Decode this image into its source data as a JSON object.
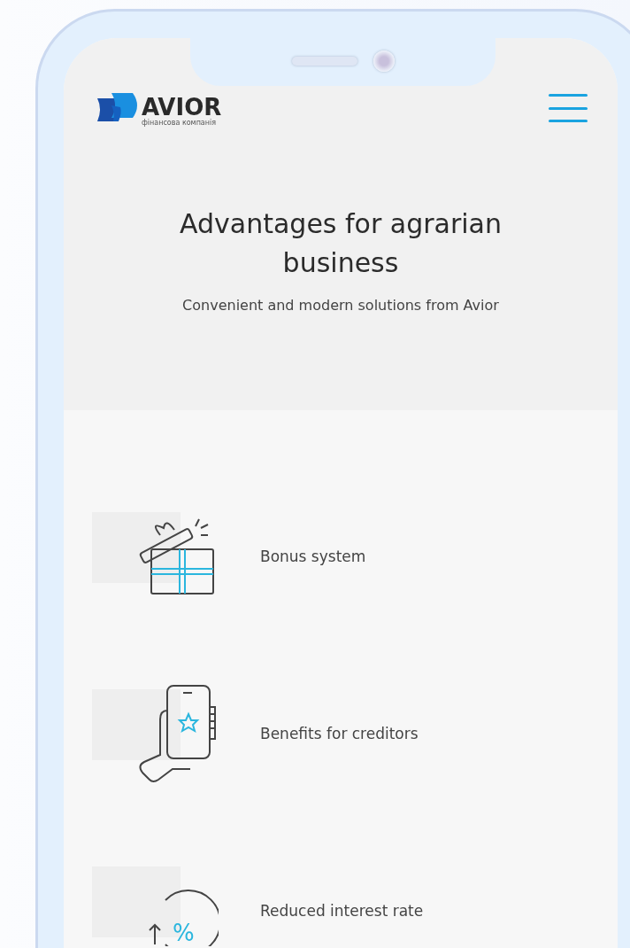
{
  "header": {
    "logo_text": "AVIOR",
    "logo_subtitle": "фінансова компанія"
  },
  "hero": {
    "title": "Advantages for agrarian business",
    "subtitle": "Convenient and modern solutions from Avior"
  },
  "advantages": [
    {
      "kind": "gift",
      "label": "Bonus system"
    },
    {
      "kind": "phone",
      "label": "Benefits for creditors"
    },
    {
      "kind": "percent",
      "label": "Reduced interest rate",
      "symbol": "%"
    }
  ]
}
